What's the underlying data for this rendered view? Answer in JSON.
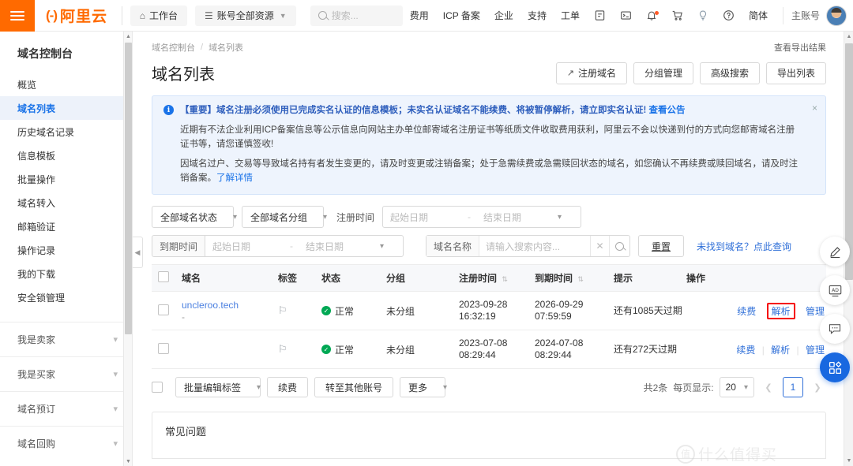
{
  "header": {
    "logo_mark": "(-)",
    "logo_text": "阿里云",
    "workbench": "工作台",
    "resources": "账号全部资源",
    "search_placeholder": "搜索...",
    "links": [
      "费用",
      "ICP 备案",
      "企业",
      "支持",
      "工单"
    ],
    "icons": [
      "app-grid-icon",
      "terminal-icon",
      "bell-icon",
      "cart-icon",
      "bulb-icon",
      "help-icon"
    ],
    "lang": "简体",
    "account": "主账号"
  },
  "sidebar": {
    "title": "域名控制台",
    "items": [
      {
        "label": "概览",
        "active": false
      },
      {
        "label": "域名列表",
        "active": true
      },
      {
        "label": "历史域名记录",
        "active": false
      },
      {
        "label": "信息模板",
        "active": false
      },
      {
        "label": "批量操作",
        "active": false
      },
      {
        "label": "域名转入",
        "active": false
      },
      {
        "label": "邮箱验证",
        "active": false
      },
      {
        "label": "操作记录",
        "active": false
      },
      {
        "label": "我的下载",
        "active": false
      },
      {
        "label": "安全锁管理",
        "active": false
      }
    ],
    "groups": [
      {
        "label": "我是卖家"
      },
      {
        "label": "我是买家"
      },
      {
        "label": "域名预订"
      },
      {
        "label": "域名回购"
      }
    ]
  },
  "breadcrumb": {
    "root": "域名控制台",
    "current": "域名列表",
    "right_link": "查看导出结果"
  },
  "page": {
    "title": "域名列表",
    "buttons": [
      {
        "label": "注册域名",
        "icon": "external-link-icon"
      },
      {
        "label": "分组管理",
        "icon": ""
      },
      {
        "label": "高级搜索",
        "icon": ""
      },
      {
        "label": "导出列表",
        "icon": ""
      }
    ]
  },
  "notice": {
    "line1": "【重要】域名注册必须使用已完成实名认证的信息模板；未实名认证域名不能续费、将被暂停解析，请立即实名认证!",
    "line1_link": "查看公告",
    "para2": "近期有不法企业利用ICP备案信息等公示信息向网站主办单位邮寄域名注册证书等纸质文件收取费用获利，阿里云不会以快递到付的方式向您邮寄域名注册证书等，请您谨慎签收!",
    "para3": "因域名过户、交易等导致域名持有者发生变更的，请及时变更或注销备案；处于急需续费或急需赎回状态的域名，如您确认不再续费或赎回域名，请及时注销备案。",
    "para3_link": "了解详情",
    "close": "×"
  },
  "filters": {
    "status_select": "全部域名状态",
    "group_select": "全部域名分组",
    "reg_time_label": "注册时间",
    "exp_time_label": "到期时间",
    "start_date": "起始日期",
    "end_date": "结束日期",
    "domain_name_label": "域名名称",
    "domain_name_placeholder": "请输入搜索内容...",
    "reset": "重置",
    "not_found_link": "未找到域名？点此查询"
  },
  "table": {
    "columns": [
      "域名",
      "标签",
      "状态",
      "分组",
      "注册时间",
      "到期时间",
      "提示",
      "操作"
    ],
    "sortable": [
      "注册时间",
      "到期时间"
    ],
    "rows": [
      {
        "domain": "uncleroo.tech",
        "domain_sub": "-",
        "status": "正常",
        "group": "未分组",
        "reg_time": "2023-09-28 16:32:19",
        "exp_time": "2026-09-29 07:59:59",
        "hint": "还有1085天过期",
        "actions": [
          "续费",
          "解析",
          "管理"
        ],
        "highlight_action": "解析"
      },
      {
        "domain": "",
        "domain_sub": "",
        "status": "正常",
        "group": "未分组",
        "reg_time": "2023-07-08 08:29:44",
        "exp_time": "2024-07-08 08:29:44",
        "hint": "还有272天过期",
        "actions": [
          "续费",
          "解析",
          "管理"
        ],
        "highlight_action": ""
      }
    ]
  },
  "table_footer": {
    "batch_tag": "批量编辑标签",
    "renew": "续费",
    "transfer": "转至其他账号",
    "more": "更多",
    "total": "共2条",
    "per_page_label": "每页显示:",
    "per_page_value": "20",
    "page_number": "1"
  },
  "faq": {
    "title": "常见问题"
  },
  "rail": {
    "buttons": [
      "pencil-icon",
      "ad-icon",
      "chat-icon",
      "apps-icon"
    ]
  },
  "watermark": {
    "text": "什么值得买",
    "mark": "值"
  },
  "colors": {
    "brand_orange": "#FF6A00",
    "link_blue": "#2f6fd8",
    "status_green": "#00a854",
    "highlight_red": "#f50000",
    "notice_bg": "#eef4fd"
  }
}
